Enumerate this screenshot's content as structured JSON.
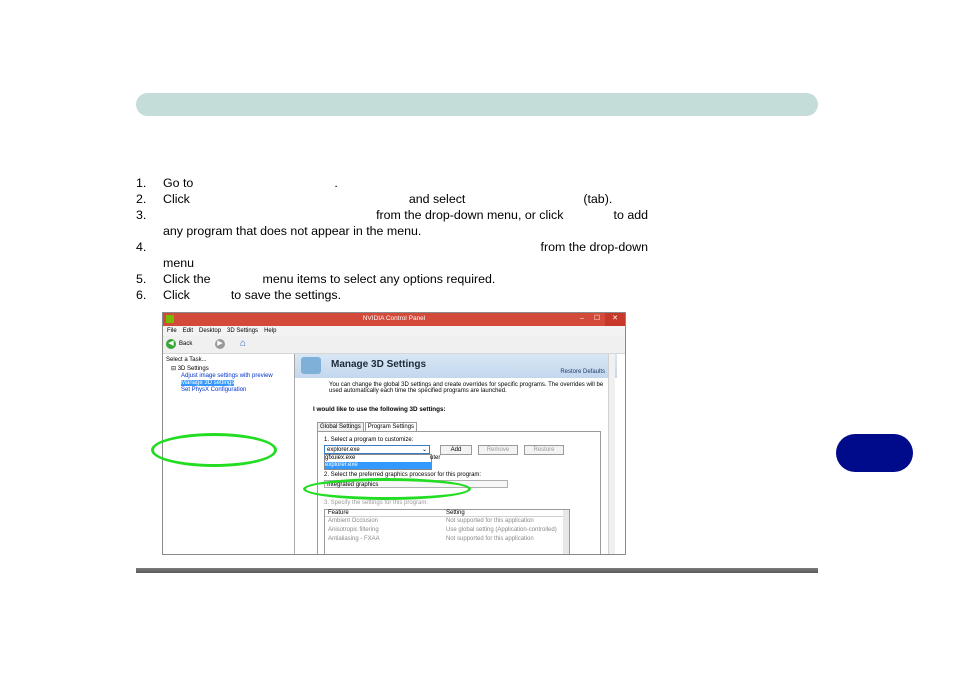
{
  "steps": [
    {
      "num": "1.",
      "parts": [
        "Go to",
        ".",
        ""
      ]
    },
    {
      "num": "2.",
      "parts": [
        "Click",
        "and select",
        "(tab)."
      ]
    },
    {
      "num": "3.",
      "parts": [
        "",
        "from the drop-down menu, or click",
        "to add"
      ],
      "cont": "any program that does not appear in the menu."
    },
    {
      "num": "4.",
      "parts": [
        "",
        "from the drop-down"
      ],
      "cont": "menu"
    },
    {
      "num": "5.",
      "parts": [
        "Click the",
        "menu items to select any options required."
      ]
    },
    {
      "num": "6.",
      "parts": [
        "Click",
        "to save the settings."
      ]
    }
  ],
  "window": {
    "title": "NVIDIA Control Panel",
    "controls": [
      "–",
      "☐",
      "✕"
    ],
    "menu": [
      "File",
      "Edit",
      "Desktop",
      "3D Settings",
      "Help"
    ],
    "toolbar": {
      "back": "Back",
      "back_icon": "arrow-left-icon",
      "home_icon": "home-icon"
    },
    "left": {
      "title": "Select a Task...",
      "root": "3D Settings",
      "children": [
        "Adjust image settings with preview",
        "Manage 3D settings",
        "Set PhysX Configuration"
      ],
      "selected": "Manage 3D settings"
    },
    "right": {
      "heading": "Manage 3D Settings",
      "restore": "Restore Defaults",
      "desc": "You can change the global 3D settings and create overrides for specific programs. The overrides will be used automatically each time the specified programs are launched.",
      "question": "I would like to use the following 3D settings:",
      "tabs": [
        "Global Settings",
        "Program Settings"
      ],
      "active_tab": "Program Settings",
      "step1": "1. Select a program to customize:",
      "program": "explorer.exe",
      "buttons": [
        "Add",
        "Remove",
        "Restore"
      ],
      "dropdown": [
        "gfxuiex.exe",
        "explorer.exe"
      ],
      "dropdown_tail": "uter",
      "step2": "2. Select the preferred graphics processor for this program:",
      "gpu": "Integrated graphics",
      "step3": "3. Specify the settings for this program:",
      "table_headers": [
        "Feature",
        "Setting"
      ],
      "table_rows": [
        [
          "Ambient Occlusion",
          "Not supported for this application"
        ],
        [
          "Anisotropic filtering",
          "Use global setting (Application-controlled)"
        ],
        [
          "Antialiasing - FXAA",
          "Not supported for this application"
        ]
      ]
    }
  }
}
